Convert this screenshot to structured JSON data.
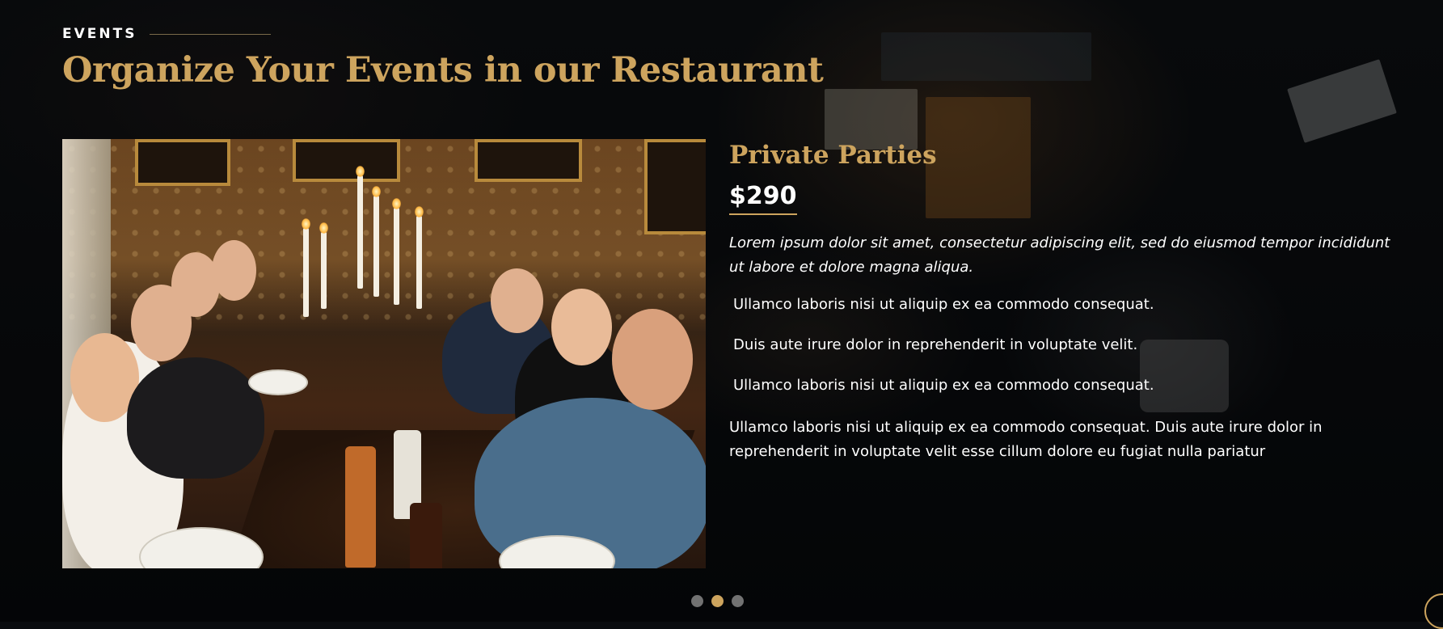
{
  "section": {
    "eyebrow": "EVENTS",
    "title": "Organize Your Events in our Restaurant"
  },
  "event": {
    "name": "Private Parties",
    "price": "$290",
    "intro": "Lorem ipsum dolor sit amet, consectetur adipiscing elit, sed do eiusmod tempor incididunt ut labore et dolore magna aliqua.",
    "features": [
      "Ullamco laboris nisi ut aliquip ex ea commodo consequat.",
      "Duis aute irure dolor in reprehenderit in voluptate velit.",
      "Ullamco laboris nisi ut aliquip ex ea commodo consequat."
    ],
    "description": "Ullamco laboris nisi ut aliquip ex ea commodo consequat. Duis aute irure dolor in reprehenderit in voluptate velit esse cillum dolore eu fugiat nulla pariatur"
  },
  "slider": {
    "active_index": 1
  },
  "colors": {
    "accent": "#cda45e",
    "background": "#0a0c0f",
    "inactive_dot": "#727272"
  }
}
